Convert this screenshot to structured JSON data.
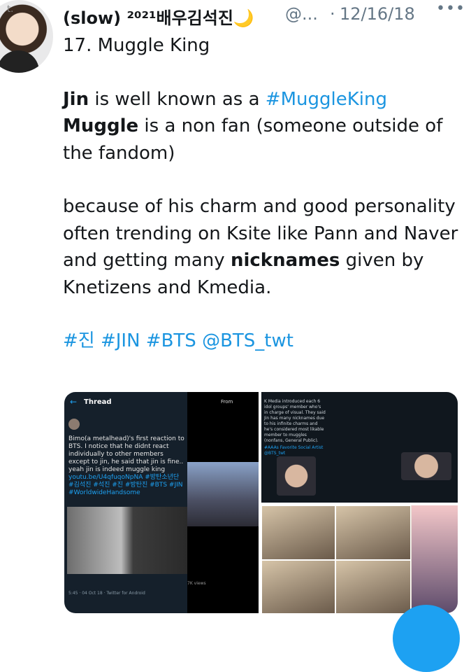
{
  "tweet": {
    "display_name": "(slow) ²⁰²¹배우김석진🌙",
    "handle": "@...",
    "separator": "·",
    "date": "12/16/18",
    "more": "•••",
    "avatar_tag": "t."
  },
  "body": {
    "line1": "17. Muggle King",
    "p2_bold": "Jin",
    "p2_text": " is well known as a ",
    "p2_hashtag": "#MuggleKing",
    "p3_bold": "Muggle",
    "p3_text": " is a non fan (someone outside of the fandom)",
    "p4_text1": "because of his charm and good personality often trending on Ksite like Pann and Naver and getting many ",
    "p4_bold": "nicknames",
    "p4_text2": " given by Knetizens and Kmedia.",
    "tags": "#진 #JIN #BTS @BTS_twt"
  },
  "media": {
    "thread_label": "Thread",
    "pane1_text": "Bimo(a metalhead)'s first reaction to BTS. I notice that he didnt react individually to other members except to jin, he said that jin is fine.. yeah jin is indeed muggle king",
    "pane1_link": "youtu.be/U4qfuqoNpNA #방탄소년단 #김석진 #석진 #진 #방탄진 #BTS #JIN #WorldwideHandsome",
    "pane1_footer": "5:45 · 04 Oct 18 · Twitter for Android",
    "pane2_from": "From",
    "pane2_footer": "7K views",
    "pane3_text": "K Media introduced each 6 idol groups' member who's in charge of visual. They said Jin has many nicknames due to his infinite charms and he's considered most likable member to muggles (nonfans, General Public).",
    "pane3_tag": "#AAAs Favorite Social Artist @BTS_twt"
  },
  "colors": {
    "link": "#1b95e0",
    "muted": "#657786",
    "twitter_blue": "#1da1f2"
  }
}
